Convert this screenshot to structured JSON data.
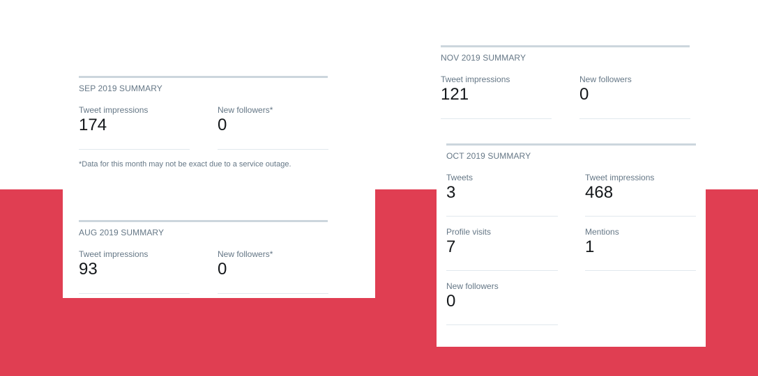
{
  "colors": {
    "accent_background": "#e03e52",
    "rule": "#ccd6dd"
  },
  "sep": {
    "heading": "SEP 2019 SUMMARY",
    "tweet_impressions_label": "Tweet impressions",
    "tweet_impressions_value": "174",
    "new_followers_label": "New followers*",
    "new_followers_value": "0",
    "note": "*Data for this month may not be exact due to a service outage."
  },
  "aug": {
    "heading": "AUG 2019 SUMMARY",
    "tweet_impressions_label": "Tweet impressions",
    "tweet_impressions_value": "93",
    "new_followers_label": "New followers*",
    "new_followers_value": "0"
  },
  "nov": {
    "heading": "NOV 2019 SUMMARY",
    "tweet_impressions_label": "Tweet impressions",
    "tweet_impressions_value": "121",
    "new_followers_label": "New followers",
    "new_followers_value": "0"
  },
  "oct": {
    "heading": "OCT 2019 SUMMARY",
    "tweets_label": "Tweets",
    "tweets_value": "3",
    "tweet_impressions_label": "Tweet impressions",
    "tweet_impressions_value": "468",
    "profile_visits_label": "Profile visits",
    "profile_visits_value": "7",
    "mentions_label": "Mentions",
    "mentions_value": "1",
    "new_followers_label": "New followers",
    "new_followers_value": "0"
  }
}
